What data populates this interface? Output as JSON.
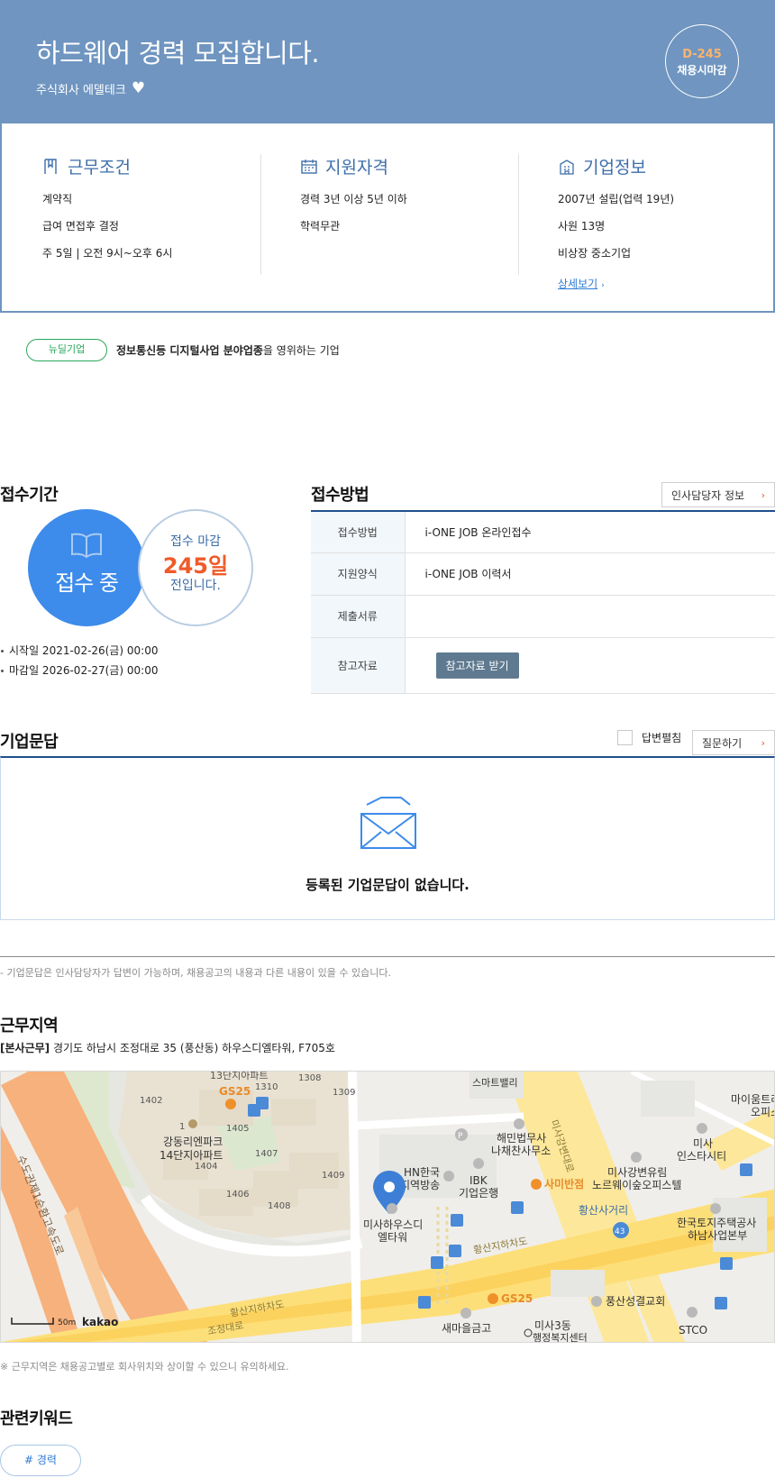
{
  "header": {
    "title": "하드웨어 경력 모집합니다.",
    "company": "주식회사 에델테크",
    "dday": "D-245",
    "dday_text": "채용시마감"
  },
  "work_conditions": {
    "title": "근무조건",
    "items": [
      "계약직",
      "급여 면접후 결정",
      "주 5일 | 오전 9시~오후 6시"
    ]
  },
  "qualifications": {
    "title": "지원자격",
    "items": [
      "경력 3년 이상 5년 이하",
      "학력무관"
    ]
  },
  "company_info": {
    "title": "기업정보",
    "items": [
      "2007년 설립(업력 19년)",
      "사원 13명",
      "비상장 중소기업"
    ],
    "detail_link": "상세보기"
  },
  "newdeal": {
    "badge": "뉴딜기업",
    "text_bold": "정보통신등 디지털사업 분야업종",
    "text_rest": "을 영위하는 기업"
  },
  "period": {
    "title": "접수기간",
    "status": "접수 중",
    "deadline_label": "접수 마감",
    "days_left": "245일",
    "days_suffix": "전입니다.",
    "start": "시작일 2021-02-26(금) 00:00",
    "end": "마감일 2026-02-27(금) 00:00"
  },
  "apply": {
    "title": "접수방법",
    "hr_button": "인사담당자 정보",
    "rows": [
      {
        "key": "접수방법",
        "value": "i-ONE JOB 온라인접수"
      },
      {
        "key": "지원양식",
        "value": "i-ONE JOB 이력서"
      },
      {
        "key": "제출서류",
        "value": ""
      },
      {
        "key": "참고자료",
        "value": ""
      }
    ],
    "ref_button": "참고자료 받기"
  },
  "qa": {
    "title": "기업문답",
    "unfold_label": "답변펼침",
    "ask_button": "질문하기",
    "empty_text": "등록된 기업문답이 없습니다.",
    "note": "- 기업문답은 인사담당자가 답변이 가능하며, 채용공고의 내용과 다른 내용이 있을 수 있습니다."
  },
  "location": {
    "title": "근무지역",
    "tag": "[본사근무]",
    "address": " 경기도 하남시 조정대로 35 (풍산동) 하우스디엘타워, F705호",
    "note": "※ 근무지역은 채용공고별로 회사위치와 상이할 수 있으니 유의하세요.",
    "map_labels": {
      "pin": "미사하우스디\n엘타워",
      "hn": "HN한국\n지역방송",
      "ibk": "IBK\n기업은행",
      "haemin": "해민법무사\n나채찬사무소",
      "samibanjeom": "사미반점",
      "misa_yurim": "미사강변유림\n노르웨이숲오피스텔",
      "misa_insta": "미사\n인스타시티",
      "mainum": "마이움트리\n오피스",
      "hwangsan_cross": "황산사거리",
      "lh": "한국토지주택공사\n하남사업본부",
      "pungsan_church": "풍산성결교회",
      "stco": "STCO",
      "saemaeul": "새마을금고",
      "misa3": "미사3동\n행정복지센터",
      "gs25_top": "GS25",
      "gs25_bottom": "GS25",
      "gangdong": "강동리엔파크\n14단지아파트",
      "hwangsan_underpass": "황산지하차도",
      "hwangsan_underpass2": "황산지하차도",
      "jojeong": "조정대로",
      "sudogwon": "수도권제1순환고속도로",
      "misa_road": "미사강변대로",
      "smart_valley": "스마트밸리",
      "apt13": "13단지아파트",
      "b1402": "1402",
      "b1308": "1308",
      "b1310": "1310",
      "b1309": "1309",
      "b1405": "1405",
      "b1404": "1404",
      "b1407": "1407",
      "b1409": "1409",
      "b1406": "1406",
      "b1408": "1408",
      "b1": "1",
      "bus43": "43",
      "scale": "50m",
      "brand": "kakao"
    }
  },
  "keywords": {
    "title": "관련키워드",
    "items": [
      "# 경력"
    ]
  },
  "colors": {
    "header_bg": "#6f95c0",
    "accent_blue": "#3d8bea",
    "deadline_orange": "#f05a28",
    "newdeal_green": "#28a85b"
  }
}
